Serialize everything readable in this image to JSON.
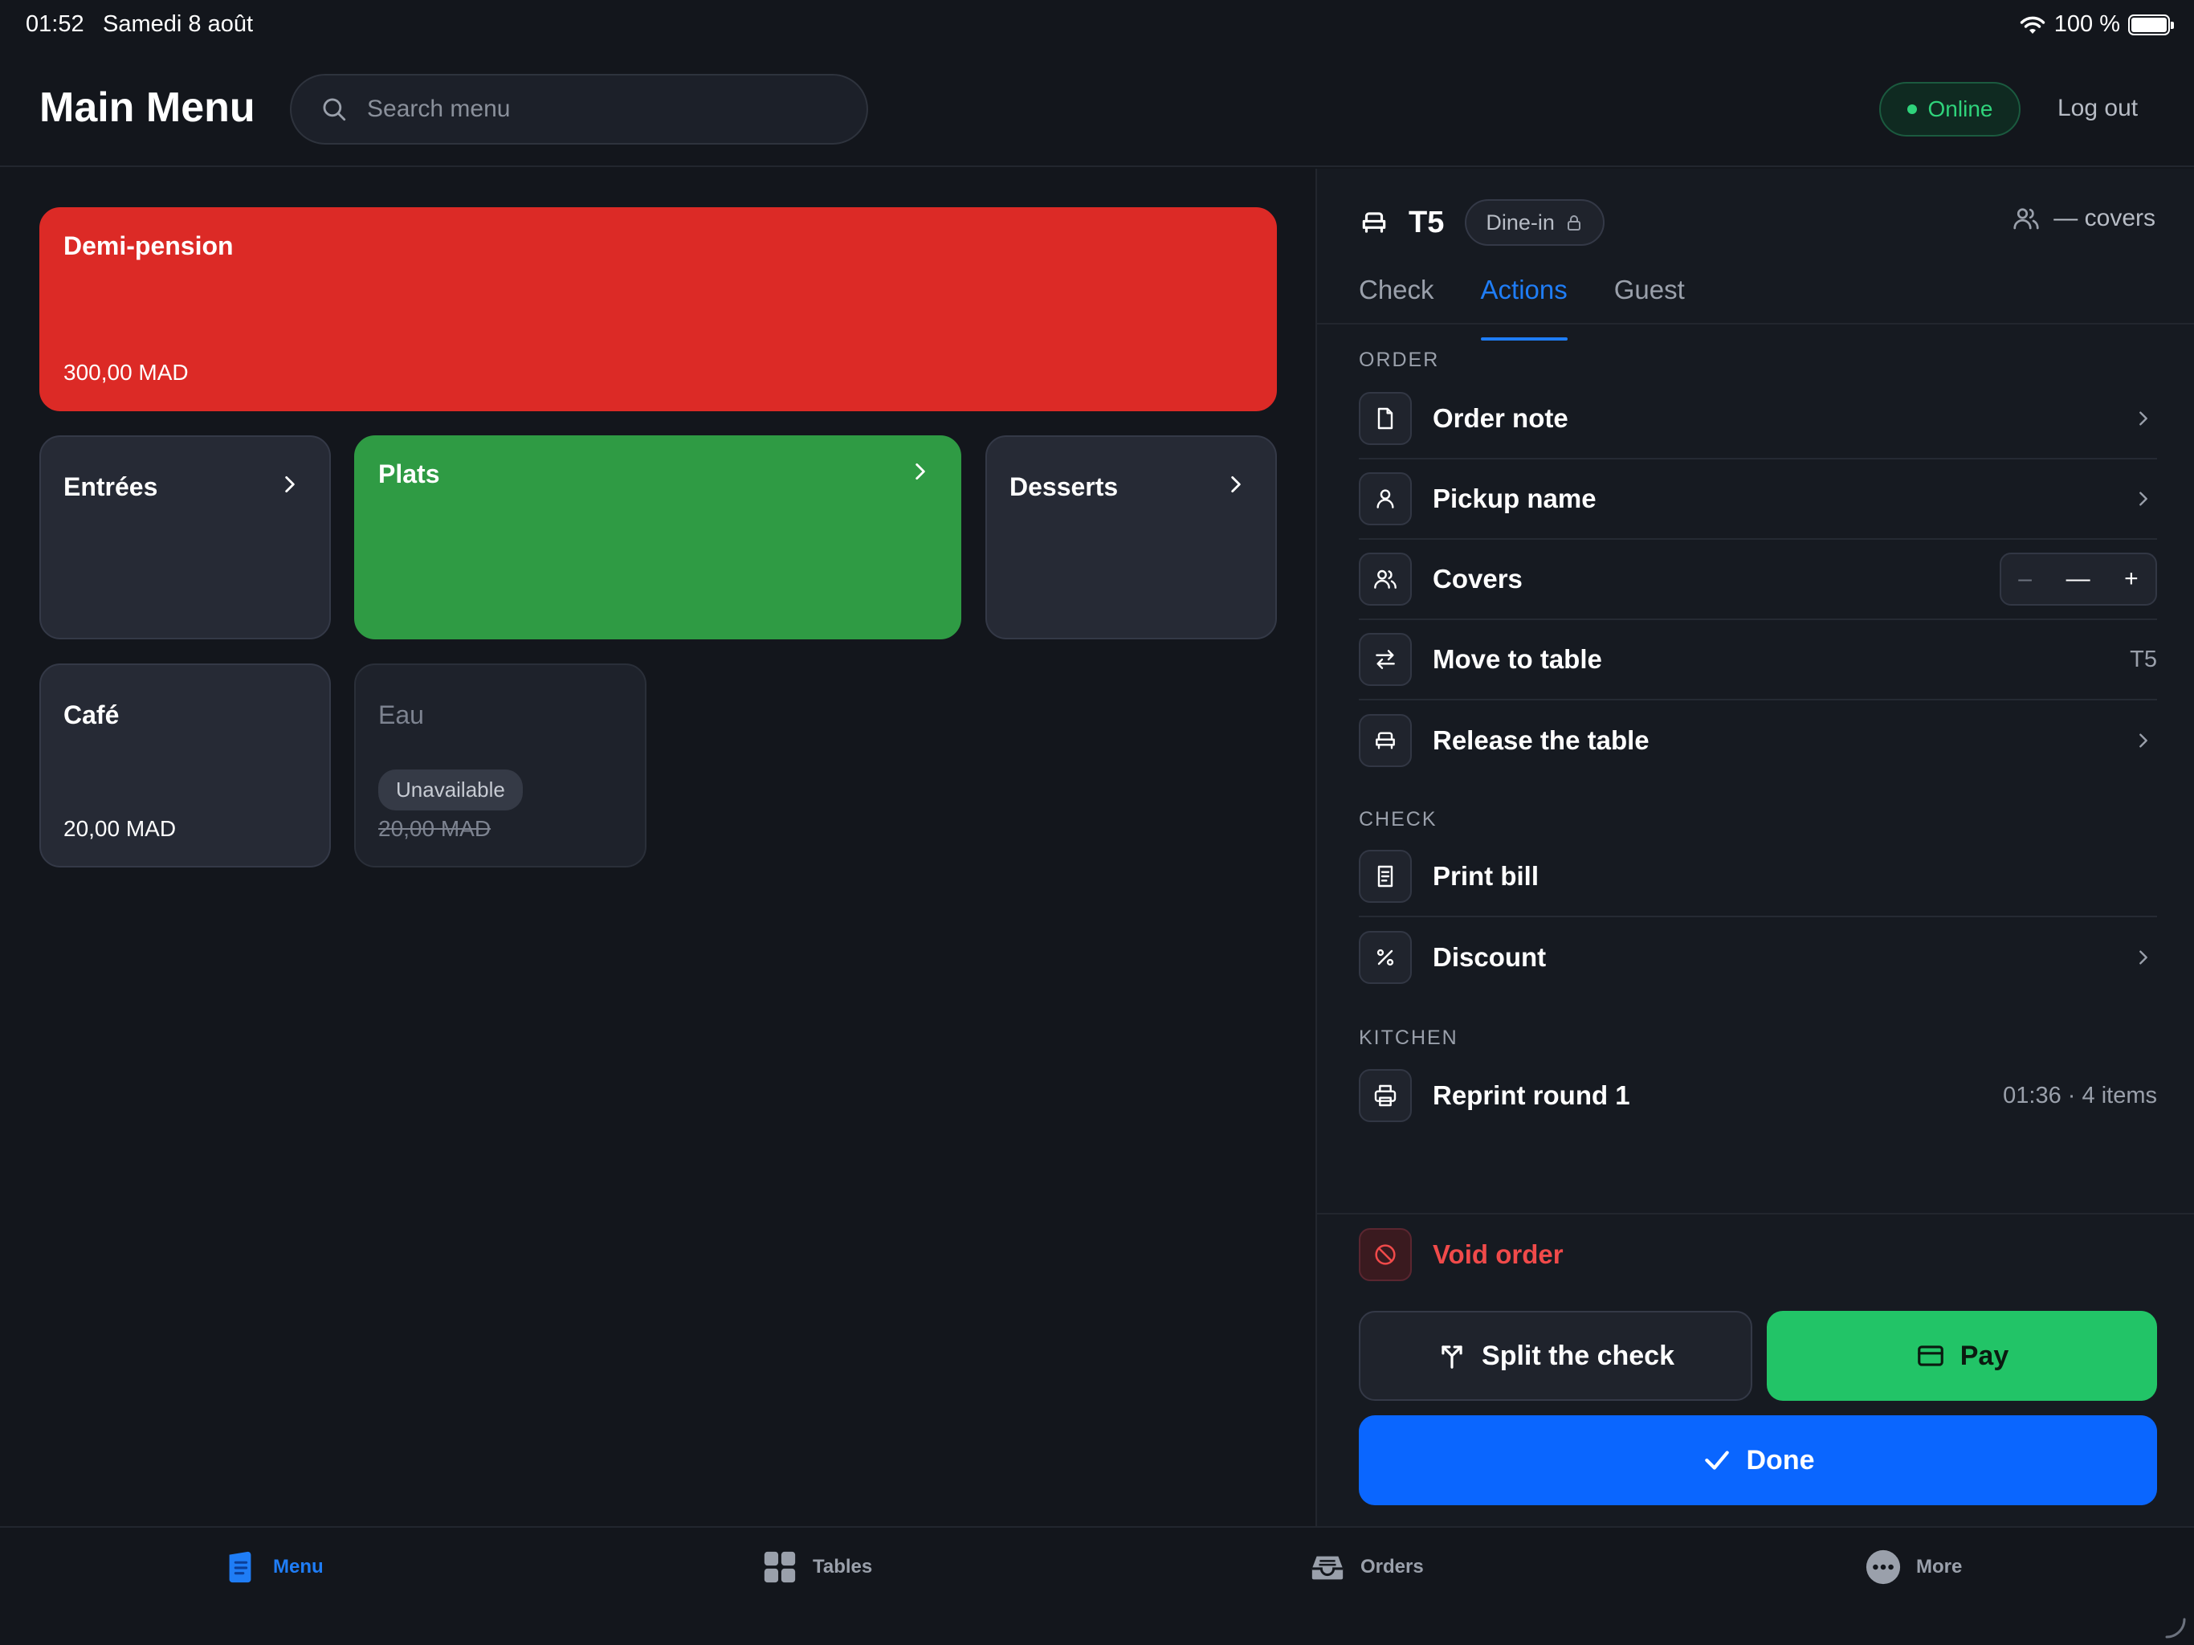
{
  "status_bar": {
    "time": "01:52",
    "date": "Samedi 8 août",
    "battery": "100 %"
  },
  "header": {
    "title": "Main Menu",
    "search_placeholder": "Search menu",
    "status": "Online",
    "logout": "Log out"
  },
  "menu": {
    "tiles": [
      {
        "name": "Demi-pension",
        "price": "300,00 MAD",
        "color": "#dc2a26"
      },
      {
        "name": "Entrées"
      },
      {
        "name": "Plats",
        "color": "#2f9b44"
      },
      {
        "name": "Desserts"
      },
      {
        "name": "Café",
        "price": "20,00 MAD"
      },
      {
        "name": "Eau",
        "price": "20,00 MAD",
        "badge": "Unavailable"
      }
    ]
  },
  "panel": {
    "table": "T5",
    "service": "Dine-in",
    "covers": "— covers",
    "tabs": [
      "Check",
      "Actions",
      "Guest"
    ],
    "active_tab": "Actions",
    "sections": {
      "order": "ORDER",
      "check": "CHECK",
      "kitchen": "KITCHEN"
    },
    "rows": {
      "order_note": "Order note",
      "pickup_name": "Pickup name",
      "covers": "Covers",
      "move_table": "Move to table",
      "move_table_value": "T5",
      "release_table": "Release the table",
      "print_bill": "Print bill",
      "discount": "Discount",
      "reprint": "Reprint round 1",
      "reprint_value": "01:36 · 4 items"
    },
    "stepper": {
      "minus": "–",
      "value": "—",
      "plus": "+"
    },
    "void": "Void order",
    "split": "Split the check",
    "pay": "Pay",
    "done": "Done",
    "colors": {
      "accent": "#0a66ff",
      "pay": "#22c467",
      "danger": "#f04a4a"
    }
  },
  "tabbar": {
    "items": [
      "Menu",
      "Tables",
      "Orders",
      "More"
    ],
    "active": "Menu"
  }
}
